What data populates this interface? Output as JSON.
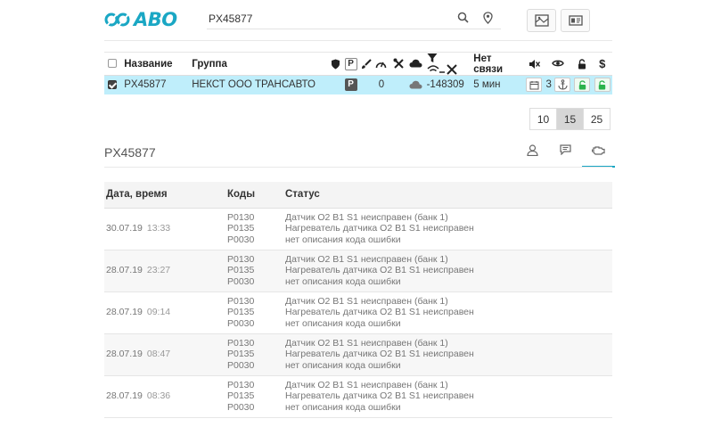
{
  "logo": {
    "text": "АВО"
  },
  "search": {
    "value": "PX45877"
  },
  "vehicles": {
    "headers": {
      "name": "Название",
      "group": "Группа",
      "no_connection": "Нет связи"
    },
    "rows": [
      {
        "name": "PX45877",
        "group": "НЕКСТ ООО ТРАНСАВТО",
        "p_count": "0",
        "temp": "-148309",
        "no_connection": "5 мин",
        "count": "3"
      }
    ]
  },
  "pager": {
    "sizes": [
      "10",
      "15",
      "25"
    ],
    "active": "15"
  },
  "detail": {
    "title": "PX45877",
    "headers": {
      "datetime": "Дата, время",
      "codes": "Коды",
      "status": "Статус"
    },
    "rows": [
      {
        "date": "30.07.19",
        "time": "13:33",
        "codes": [
          "P0130",
          "P0135",
          "P0030"
        ],
        "statuses": [
          "Датчик O2 B1 S1 неисправен (банк 1)",
          "Нагреватель датчика O2 B1 S1 неисправен",
          "нет описания кода ошибки"
        ]
      },
      {
        "date": "28.07.19",
        "time": "23:27",
        "codes": [
          "P0130",
          "P0135",
          "P0030"
        ],
        "statuses": [
          "Датчик O2 B1 S1 неисправен (банк 1)",
          "Нагреватель датчика O2 B1 S1 неисправен",
          "нет описания кода ошибки"
        ]
      },
      {
        "date": "28.07.19",
        "time": "09:14",
        "codes": [
          "P0130",
          "P0135",
          "P0030"
        ],
        "statuses": [
          "Датчик O2 B1 S1 неисправен (банк 1)",
          "Нагреватель датчика O2 B1 S1 неисправен",
          "нет описания кода ошибки"
        ]
      },
      {
        "date": "28.07.19",
        "time": "08:47",
        "codes": [
          "P0130",
          "P0135",
          "P0030"
        ],
        "statuses": [
          "Датчик O2 B1 S1 неисправен (банк 1)",
          "Нагреватель датчика O2 B1 S1 неисправен",
          "нет описания кода ошибки"
        ]
      },
      {
        "date": "28.07.19",
        "time": "08:36",
        "codes": [
          "P0130",
          "P0135",
          "P0030"
        ],
        "statuses": [
          "Датчик O2 B1 S1 неисправен (банк 1)",
          "Нагреватель датчика O2 B1 S1 неисправен",
          "нет описания кода ошибки"
        ]
      }
    ]
  },
  "colors": {
    "accent": "#1aa7c4",
    "selected_row": "#bfeefb",
    "green": "#2bb24c"
  },
  "icons": [
    "logo-icon",
    "search-icon",
    "map-pin-icon",
    "map-icon",
    "id-card-icon",
    "shield-icon",
    "parking-icon",
    "brush-icon",
    "speedometer-icon",
    "tools-icon",
    "cloud-icon",
    "filter-icon",
    "no-signal-icon",
    "mute-icon",
    "eye-icon",
    "lock-icon",
    "dollar-icon",
    "calendar-icon",
    "anchor-icon",
    "user-icon",
    "chat-icon",
    "engine-icon"
  ]
}
